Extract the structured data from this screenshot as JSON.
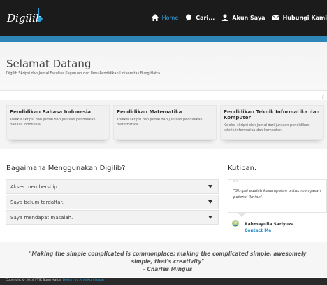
{
  "brand": {
    "name": "Digilib"
  },
  "nav": [
    {
      "label": "Home",
      "icon": "home-icon",
      "active": true
    },
    {
      "label": "Cari...",
      "icon": "search-icon",
      "active": false
    },
    {
      "label": "Akun Saya",
      "icon": "user-icon",
      "active": false
    },
    {
      "label": "Hubungi Kami",
      "icon": "mail-icon",
      "active": false
    }
  ],
  "header": {
    "title": "Selamat Datang",
    "subtitle": "Digilib Skripsi dan Jurnal Fakultas Keguruan dan Ilmu Pendidikan Universitas Bung Hatta"
  },
  "cards": [
    {
      "title": "Pendidikan Bahasa Indonesia",
      "text": "Koleksi skripsi dan jurnal dari jurusan pendidikan bahasa indonesia."
    },
    {
      "title": "Pendidikan Matematika",
      "text": "Koleksi skripsi dan jurnal dari jurusan pendidikan matematika."
    },
    {
      "title": "Pendidikan Teknik Informatika dan Komputer",
      "text": "Koleksi skripsi dan jurnal dari jurusan pendidikan teknik informatika dan komputer."
    }
  ],
  "how": {
    "title": "Bagaimana Menggunakan Digilib?",
    "items": [
      "Akses membership.",
      "Saya belum terdaftar.",
      "Saya mendapat masalah."
    ]
  },
  "quote": {
    "title": "Kutipan.",
    "text": "\"Skripsi adalah kesempatan untuk mengasah potensi ilmiah\".",
    "author": "Rahmayulia Sariyuza",
    "contact": "Contact Me"
  },
  "footer_quote": {
    "text": "\"Making the simple complicated is commonplace; making the complicated simple, awesomely simple, that's creativity\"",
    "author": "- Charles Mingus"
  },
  "footer": {
    "copyright": "Copyright © 2014 FTIK Bung Hatta.",
    "design": "Design by Arya Kurniawan"
  },
  "colors": {
    "accent": "#2c9fd7",
    "topbar": "#1b1b1b",
    "bluebar": "#2e86b6"
  }
}
